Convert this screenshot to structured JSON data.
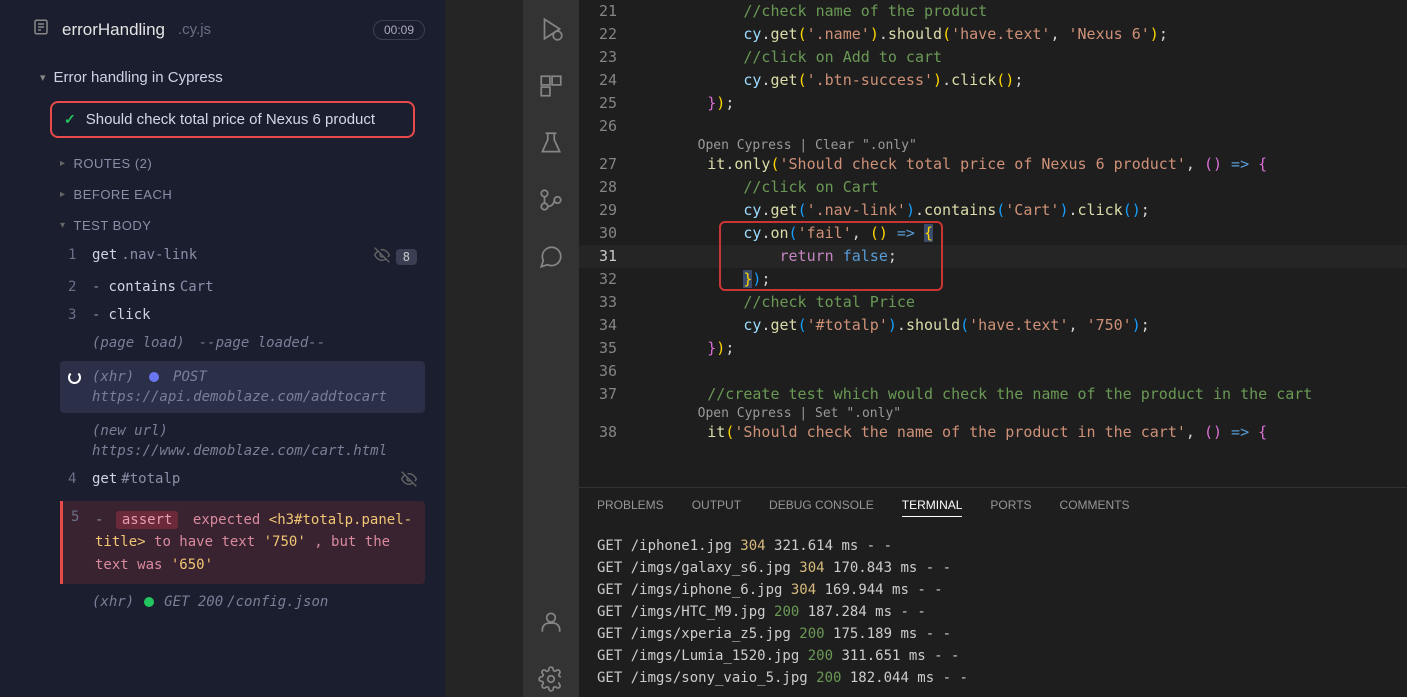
{
  "spec": {
    "name": "errorHandling",
    "extension": ".cy.js",
    "timer": "00:09"
  },
  "suite": {
    "title": "Error handling in Cypress"
  },
  "test": {
    "title": "Should check total price of Nexus 6 product"
  },
  "sections": {
    "routes": "ROUTES (2)",
    "before_each": "BEFORE EACH",
    "test_body": "TEST BODY"
  },
  "commands": {
    "c1_num": "1",
    "c1_method": "get",
    "c1_arg": ".nav-link",
    "c1_badge": "8",
    "c2_num": "2",
    "c2_method": "contains",
    "c2_arg": "Cart",
    "c3_num": "3",
    "c3_method": "click",
    "pageload_a": "(page load)",
    "pageload_b": "--page loaded--",
    "xhr_label": "(xhr)",
    "xhr_post": "POST",
    "xhr_url": "https://api.demoblaze.com/addtocart",
    "newurl_a": "(new url)",
    "newurl_b": "https://www.demoblaze.com/cart.html",
    "c4_num": "4",
    "c4_method": "get",
    "c4_arg": "#totalp",
    "c5_num": "5",
    "assert_pill": "assert",
    "assert_prefix": "expected",
    "assert_el": "<h3#totalp.panel-title>",
    "assert_mid1": "to have text",
    "assert_expected": "'750'",
    "assert_mid2": ", but the text was",
    "assert_actual": "'650'",
    "xhr2_status": "GET 200",
    "xhr2_path": "/config.json"
  },
  "codelens": {
    "open_clear": "Open Cypress | Clear \".only\"",
    "open_set": "Open Cypress | Set \".only\""
  },
  "code": {
    "l21_a": "//check name of the product",
    "l22_a": "cy",
    "l22_b": ".",
    "l22_c": "get",
    "l22_d": "(",
    "l22_e": "'.name'",
    "l22_f": ")",
    "l22_g": ".",
    "l22_h": "should",
    "l22_i": "(",
    "l22_j": "'have.text'",
    "l22_k": ", ",
    "l22_l": "'Nexus 6'",
    "l22_m": ")",
    "l22_n": ";",
    "l23_a": "//click on Add to cart",
    "l24_a": "cy",
    "l24_b": ".",
    "l24_c": "get",
    "l24_d": "(",
    "l24_e": "'.btn-success'",
    "l24_f": ")",
    "l24_g": ".",
    "l24_h": "click",
    "l24_i": "()",
    "l24_j": ";",
    "l25_a": "}",
    "l25_b": ")",
    "l25_c": ";",
    "l27_a": "it",
    "l27_b": ".",
    "l27_c": "only",
    "l27_d": "(",
    "l27_e": "'Should check total price of Nexus 6 product'",
    "l27_f": ", ",
    "l27_g": "()",
    "l27_h": " => ",
    "l27_i": "{",
    "l28_a": "//click on Cart",
    "l29_a": "cy",
    "l29_b": ".",
    "l29_c": "get",
    "l29_d": "(",
    "l29_e": "'.nav-link'",
    "l29_f": ")",
    "l29_g": ".",
    "l29_h": "contains",
    "l29_i": "(",
    "l29_j": "'Cart'",
    "l29_k": ")",
    "l29_l": ".",
    "l29_m": "click",
    "l29_n": "()",
    "l29_o": ";",
    "l30_a": "cy",
    "l30_b": ".",
    "l30_c": "on",
    "l30_d": "(",
    "l30_e": "'fail'",
    "l30_f": ", ",
    "l30_g": "()",
    "l30_h": " => ",
    "l30_i": "{",
    "l31_a": "return",
    "l31_b": " ",
    "l31_c": "false",
    "l31_d": ";",
    "l32_a": "}",
    "l32_b": ")",
    "l32_c": ";",
    "l33_a": "//check total Price",
    "l34_a": "cy",
    "l34_b": ".",
    "l34_c": "get",
    "l34_d": "(",
    "l34_e": "'#totalp'",
    "l34_f": ")",
    "l34_g": ".",
    "l34_h": "should",
    "l34_i": "(",
    "l34_j": "'have.text'",
    "l34_k": ", ",
    "l34_l": "'750'",
    "l34_m": ")",
    "l34_n": ";",
    "l35_a": "}",
    "l35_b": ")",
    "l35_c": ";",
    "l37_a": "//create test which would check the name of the product in the cart",
    "l38_a": "it",
    "l38_b": "(",
    "l38_c": "'Should check the name of the product in the cart'",
    "l38_d": ", ",
    "l38_e": "()",
    "l38_f": " => ",
    "l38_g": "{"
  },
  "lines": {
    "n21": "21",
    "n22": "22",
    "n23": "23",
    "n24": "24",
    "n25": "25",
    "n26": "26",
    "n27": "27",
    "n28": "28",
    "n29": "29",
    "n30": "30",
    "n31": "31",
    "n32": "32",
    "n33": "33",
    "n34": "34",
    "n35": "35",
    "n36": "36",
    "n37": "37",
    "n38": "38"
  },
  "panel_tabs": {
    "problems": "PROBLEMS",
    "output": "OUTPUT",
    "debug_console": "DEBUG CONSOLE",
    "terminal": "TERMINAL",
    "ports": "PORTS",
    "comments": "COMMENTS"
  },
  "terminal": [
    {
      "prefix": "GET /iphone1.jpg ",
      "code": "304",
      "codeClass": "http-304",
      "suffix": " 321.614 ms - -"
    },
    {
      "prefix": "GET /imgs/galaxy_s6.jpg ",
      "code": "304",
      "codeClass": "http-304",
      "suffix": " 170.843 ms - -"
    },
    {
      "prefix": "GET /imgs/iphone_6.jpg ",
      "code": "304",
      "codeClass": "http-304",
      "suffix": " 169.944 ms - -"
    },
    {
      "prefix": "GET /imgs/HTC_M9.jpg ",
      "code": "200",
      "codeClass": "http-200",
      "suffix": " 187.284 ms - -"
    },
    {
      "prefix": "GET /imgs/xperia_z5.jpg ",
      "code": "200",
      "codeClass": "http-200",
      "suffix": " 175.189 ms - -"
    },
    {
      "prefix": "GET /imgs/Lumia_1520.jpg ",
      "code": "200",
      "codeClass": "http-200",
      "suffix": " 311.651 ms - -"
    },
    {
      "prefix": "GET /imgs/sony_vaio_5.jpg ",
      "code": "200",
      "codeClass": "http-200",
      "suffix": " 182.044 ms - -"
    }
  ]
}
